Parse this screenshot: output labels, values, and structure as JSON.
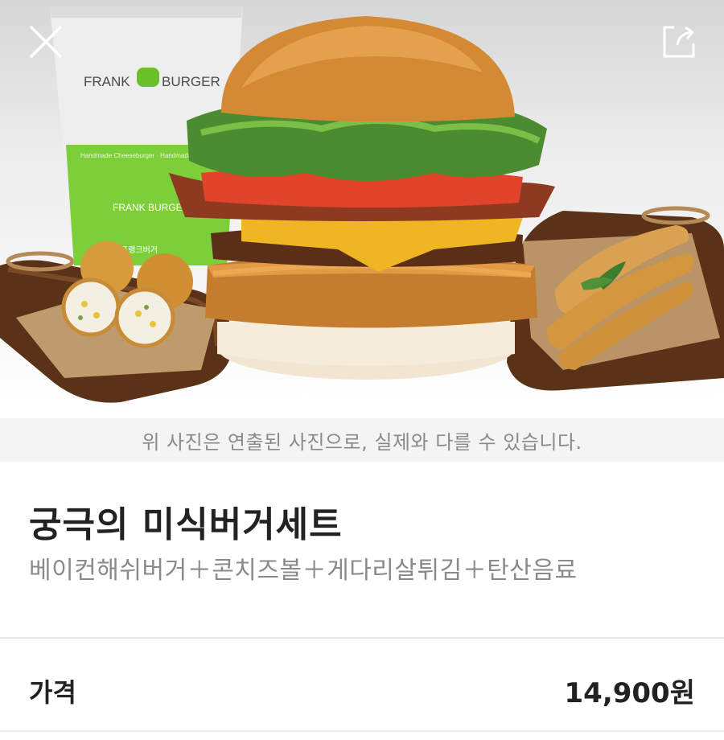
{
  "hero": {
    "cup_brand_top": "FRANK",
    "cup_brand_top2": "BURGER",
    "cup_brand_small": "FRANK BURGER",
    "cup_tagline": "Handmade Cheeseburger · Handmade Cheeseburger",
    "cup_korean": "프랭크버거",
    "close_icon": "close-icon",
    "share_icon": "share-icon"
  },
  "notice": {
    "text": "위 사진은 연출된 사진으로, 실제와 다를 수 있습니다."
  },
  "product": {
    "title": "궁극의 미식버거세트",
    "description": "베이컨해쉬버거＋콘치즈볼＋게다리살튀김＋탄산음료"
  },
  "price": {
    "label": "가격",
    "value": "14,900원"
  }
}
